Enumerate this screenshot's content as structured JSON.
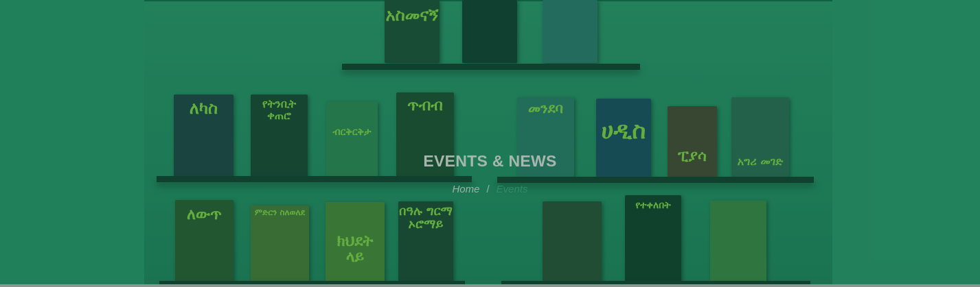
{
  "hero": {
    "title": "EVENTS & NEWS",
    "breadcrumb": {
      "home": "Home",
      "separator": "/",
      "current": "Events"
    }
  },
  "books": {
    "b1": "አስመናኝ",
    "b2": "ለካስ",
    "b3": "የትንቢት ቀጠሮ",
    "b4": "ብርቅርቅታ",
    "b5": "ጥብብ",
    "b6": "መንደባ",
    "b7": "ሀዲስ",
    "b8": "ፒያሳ",
    "b9": "አግሪ መገድ",
    "b10": "ለውጥ",
    "b11": "ምድርን ስለወለደ",
    "b12": "ክህደት ላይ",
    "b13": "በዓሉ ግርማ ኦሮማይ",
    "b14": "የተቀለበት"
  },
  "colors": {
    "overlay": "#1f7a57",
    "title": "#a7b7ae",
    "breadcrumb": "#9ab2a6",
    "book_text": "#8fd23a"
  }
}
